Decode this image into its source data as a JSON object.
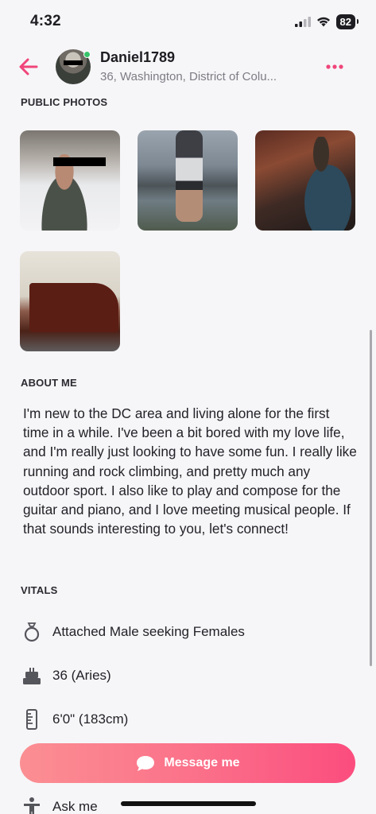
{
  "status_bar": {
    "time": "4:32",
    "battery": "82",
    "icons": [
      "signal-icon",
      "wifi-icon",
      "battery-icon"
    ]
  },
  "header": {
    "username": "Daniel1789",
    "location": "36, Washington, District of Colu...",
    "accent_color": "#f0457a",
    "online": true
  },
  "public_photos": {
    "title": "PUBLIC PHOTOS",
    "count": 4
  },
  "about": {
    "title": "ABOUT ME",
    "text": "I'm new to the DC area and living alone for the first time in a while. I've been a bit bored with my love life, and I'm really just looking to have some fun. I really like running and rock climbing, and pretty much any outdoor sport. I also like to play and compose for the guitar and piano, and I love meeting musical people. If that sounds interesting to you, let's connect!"
  },
  "vitals": {
    "title": "VITALS",
    "items": [
      {
        "icon": "ring-icon",
        "label": "Attached Male seeking Females"
      },
      {
        "icon": "cake-icon",
        "label": "36 (Aries)"
      },
      {
        "icon": "ruler-icon",
        "label": "6'0\" (183cm)"
      },
      {
        "icon": "person-icon",
        "label": "Ask me"
      }
    ]
  },
  "actions": {
    "message_label": "Message me"
  }
}
